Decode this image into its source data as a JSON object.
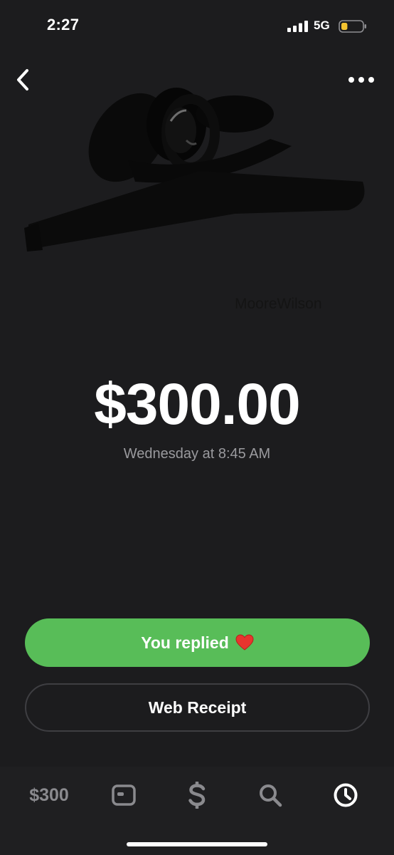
{
  "status_bar": {
    "time": "2:27",
    "network": "5G",
    "battery_level": 0.3,
    "battery_color": "#f4c430"
  },
  "header": {
    "back_icon": "chevron-left-icon",
    "more_icon": "ellipsis-icon"
  },
  "profile": {
    "watermark": "MooreWilson"
  },
  "payment": {
    "amount": "$300.00",
    "date": "Wednesday at 8:45 AM"
  },
  "actions": {
    "reply_label": "You replied",
    "reply_emoji_icon": "red-heart-icon",
    "reply_color": "#58bd58",
    "receipt_label": "Web Receipt"
  },
  "tab_bar": {
    "balance_label": "$300",
    "tabs": [
      "card-icon",
      "dollar-icon",
      "search-icon",
      "clock-icon"
    ],
    "active_tab": "clock-icon"
  }
}
